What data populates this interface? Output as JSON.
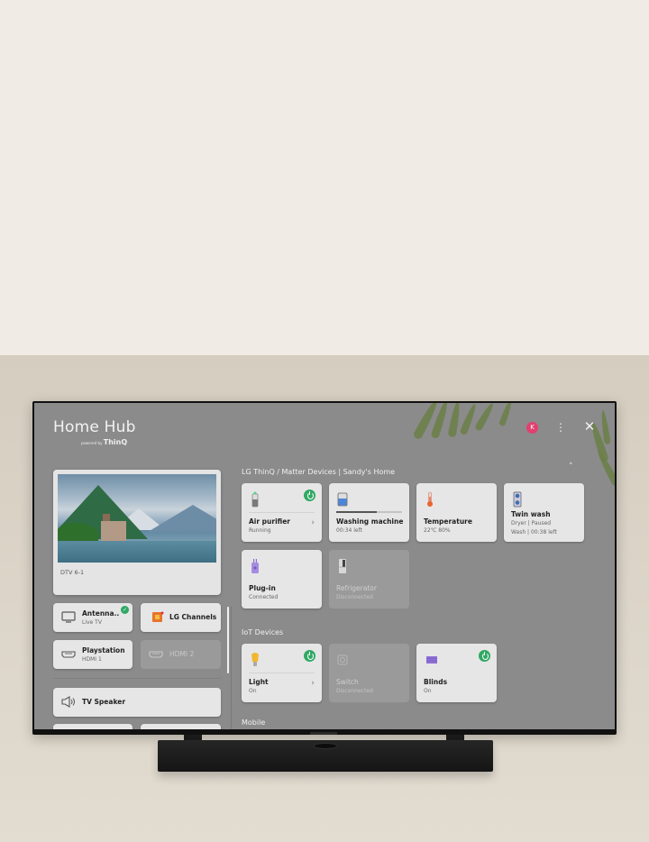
{
  "header": {
    "title": "Home Hub",
    "powered_by": "powered by",
    "brand": "ThinQ",
    "avatar_initial": "K",
    "menu_icon": "⋮",
    "close_icon": "✕"
  },
  "preview": {
    "channel": "DTV 6-1"
  },
  "inputs": [
    {
      "name": "Antenna..",
      "sub": "Live TV",
      "icon": "tv-icon",
      "selected": true
    },
    {
      "name": "LG Channels",
      "sub": "",
      "icon": "lg-channels-icon",
      "selected": false
    },
    {
      "name": "Playstation",
      "sub": "HDMI 1",
      "icon": "hdmi-icon",
      "selected": false
    },
    {
      "name": "HDMI 2",
      "sub": "",
      "icon": "hdmi-icon",
      "selected": false,
      "disabled": true
    }
  ],
  "audio": {
    "label": "TV Speaker"
  },
  "thinq": {
    "section_title": "LG ThinQ / Matter Devices | Sandy's Home",
    "collapse_icon": "˄",
    "devices": [
      {
        "name": "Air purifier",
        "status": "Running",
        "power": true,
        "chevron": true
      },
      {
        "name": "Washing machine",
        "status": "00:34 left",
        "progress": 0.62
      },
      {
        "name": "Temperature",
        "status": "22℃ 80%"
      },
      {
        "name": "Twin wash",
        "status_line1": "Dryer | Paused",
        "status_line2": "Wash | 00:38 left"
      },
      {
        "name": "Plug-in",
        "status": "Connected"
      },
      {
        "name": "Refrigerator",
        "status": "Disconnected",
        "disconnected": true
      }
    ]
  },
  "iot": {
    "section_title": "IoT Devices",
    "devices": [
      {
        "name": "Light",
        "status": "On",
        "power": true,
        "chevron": true
      },
      {
        "name": "Switch",
        "status": "Disconnected",
        "disconnected": true
      },
      {
        "name": "Blinds",
        "status": "On",
        "power": true
      }
    ]
  },
  "mobile": {
    "section_title": "Mobile"
  },
  "icons": {
    "chevron_right": "›",
    "check": "✓"
  }
}
